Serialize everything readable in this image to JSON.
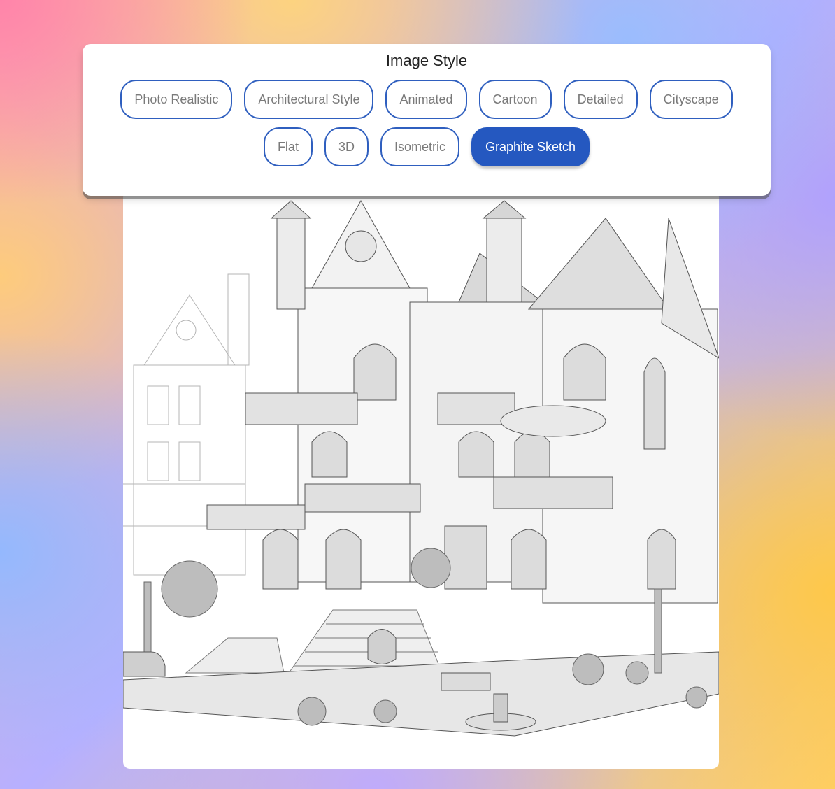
{
  "panel": {
    "title": "Image Style",
    "options": [
      {
        "label": "Photo Realistic"
      },
      {
        "label": "Architectural Style"
      },
      {
        "label": "Animated"
      },
      {
        "label": "Cartoon"
      },
      {
        "label": "Detailed"
      },
      {
        "label": "Cityscape"
      },
      {
        "label": "Flat"
      },
      {
        "label": "3D"
      },
      {
        "label": "Isometric"
      },
      {
        "label": "Graphite Sketch"
      }
    ],
    "selected": "Graphite Sketch"
  },
  "colors": {
    "accent": "#2558c0",
    "chip_border": "#2f5fbf",
    "chip_text": "#7a7a7a"
  }
}
